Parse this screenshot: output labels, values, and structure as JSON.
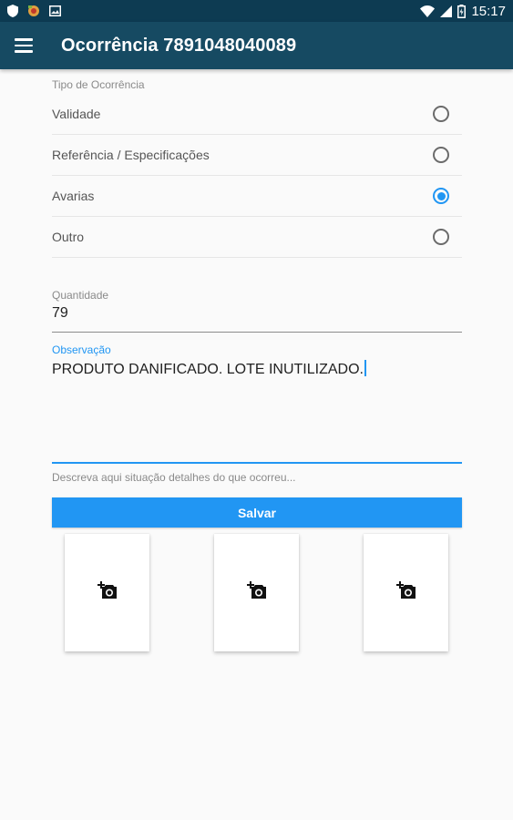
{
  "status_bar": {
    "time": "15:17",
    "icons": [
      "shield-icon",
      "app-notification-icon",
      "image-icon",
      "wifi-icon",
      "signal-icon",
      "battery-icon"
    ]
  },
  "app_bar": {
    "title": "Ocorrência 7891048040089",
    "menu_icon": "menu-icon"
  },
  "occurrence_type": {
    "label": "Tipo de Ocorrência",
    "options": [
      {
        "label": "Validade",
        "checked": false
      },
      {
        "label": "Referência / Especificações",
        "checked": false
      },
      {
        "label": "Avarias",
        "checked": true
      },
      {
        "label": "Outro",
        "checked": false
      }
    ]
  },
  "quantity": {
    "label": "Quantidade",
    "value": "79"
  },
  "observation": {
    "label": "Observação",
    "value": "PRODUTO DANIFICADO. LOTE INUTILIZADO.",
    "helper": "Descreva aqui situação detalhes do que ocorreu..."
  },
  "save_button": {
    "label": "Salvar"
  },
  "photos": [
    {
      "icon": "add-photo-icon"
    },
    {
      "icon": "add-photo-icon"
    },
    {
      "icon": "add-photo-icon"
    }
  ],
  "colors": {
    "status_bar": "#0d3b52",
    "app_bar": "#164a62",
    "accent": "#2196f3",
    "background": "#fafafa"
  }
}
